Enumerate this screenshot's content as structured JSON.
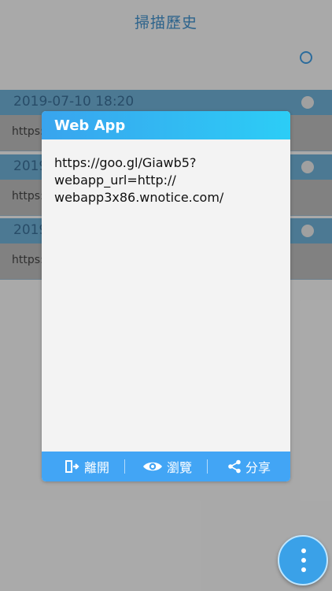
{
  "header": {
    "title": "掃描歷史"
  },
  "history": [
    {
      "date": "2019-07-10 18:20",
      "url": "https:"
    },
    {
      "date": "2019",
      "url": "https:"
    },
    {
      "date": "2019",
      "url": "https:"
    }
  ],
  "dialog": {
    "title": "Web App",
    "content_lines": [
      "https://goo.gl/Giawb5?",
      "webapp_url=http://",
      "webapp3x86.wnotice.com/"
    ],
    "buttons": {
      "exit_label": "離開",
      "browse_label": "瀏覽",
      "share_label": "分享"
    }
  },
  "icons": {
    "select_all": "radio-icon",
    "exit": "exit-door-icon",
    "browse": "eye-icon",
    "share": "share-icon",
    "fab": "more-vertical-icon"
  },
  "colors": {
    "accent": "#42a5f5",
    "header_gradient_start": "#39a4ee",
    "header_gradient_end": "#2ccdf6",
    "title": "#3f8fc9"
  }
}
